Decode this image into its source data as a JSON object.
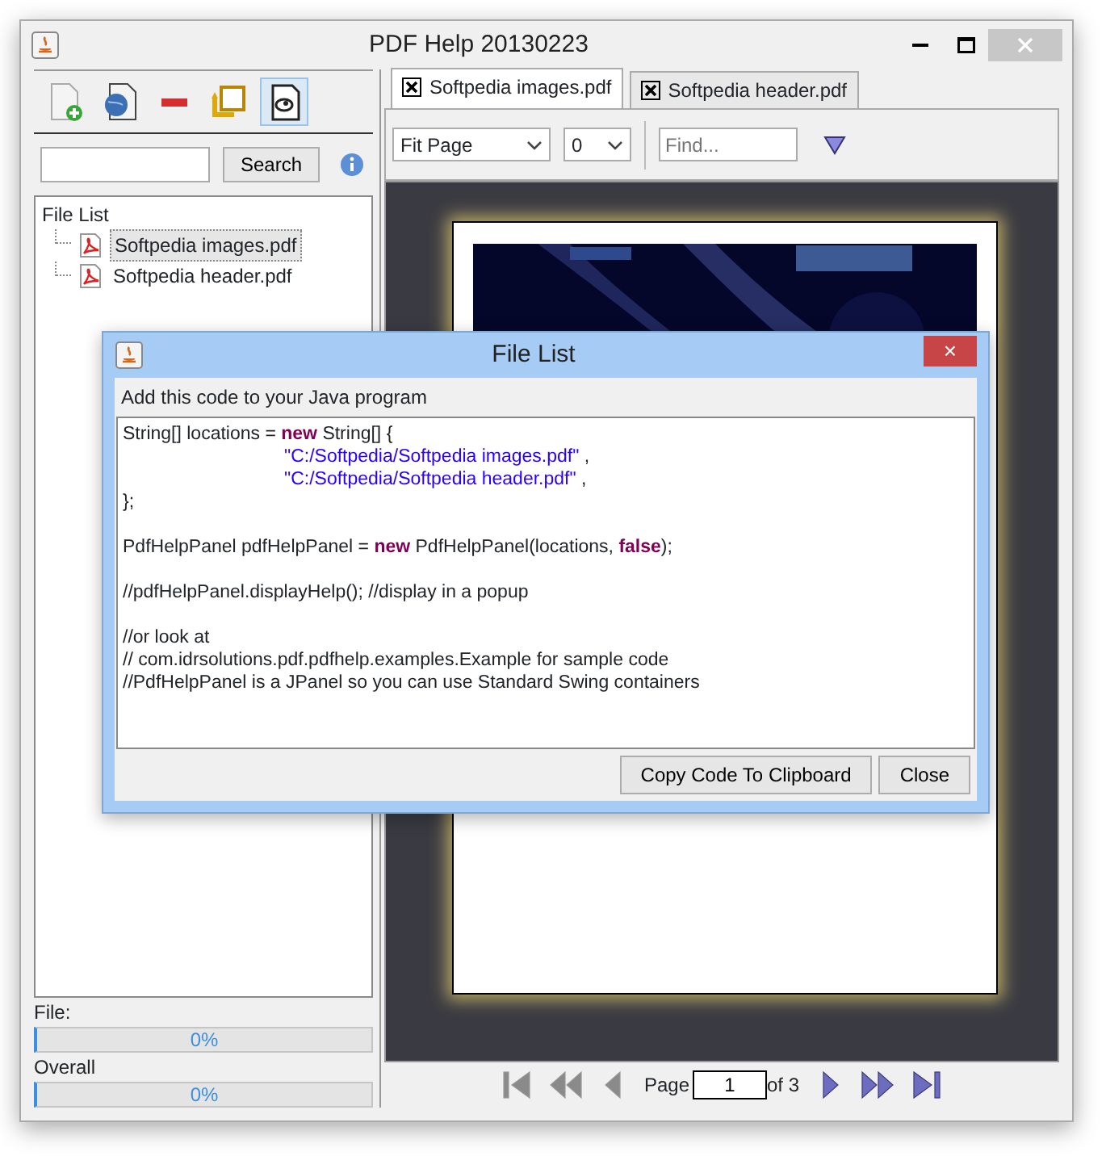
{
  "window": {
    "title": "PDF Help 20130223"
  },
  "toolbar": [
    {
      "kind": "add-file",
      "pressed": false
    },
    {
      "kind": "globe-file",
      "pressed": false
    },
    {
      "kind": "remove",
      "pressed": false
    },
    {
      "kind": "refresh",
      "pressed": false
    },
    {
      "kind": "help-file",
      "pressed": true
    }
  ],
  "search": {
    "button": "Search"
  },
  "tree": {
    "label": "File List",
    "children": [
      {
        "label": "Softpedia images.pdf",
        "selected": true
      },
      {
        "label": "Softpedia header.pdf",
        "selected": false
      }
    ]
  },
  "progress": [
    {
      "label": "File:",
      "level": 0,
      "reading": "0%"
    },
    {
      "label": "Overall",
      "level": 0,
      "reading": "0%"
    }
  ],
  "tabs": [
    {
      "label": "Softpedia images.pdf",
      "selected": true
    },
    {
      "label": "Softpedia header.pdf",
      "selected": false
    }
  ],
  "viewer_toolbar": {
    "zoom": "Fit Page",
    "rotation": "0",
    "find_placeholder": "Find..."
  },
  "navigation": {
    "buttons": [
      {
        "kind": "first",
        "disabled": true
      },
      {
        "kind": "back-ten",
        "disabled": true
      },
      {
        "kind": "back",
        "disabled": true
      }
    ],
    "page_label": "Page",
    "page": "1",
    "of": "of 3",
    "forward": [
      {
        "kind": "next",
        "disabled": false
      },
      {
        "kind": "forward-ten",
        "disabled": false
      },
      {
        "kind": "last",
        "disabled": false
      }
    ]
  },
  "dialog": {
    "title": "File List",
    "close": "×",
    "heading": "Add this code to your Java program",
    "code": [
      {
        "indented": false,
        "blank_before": false,
        "segments": [
          {
            "kind": "plain",
            "text": "String[] locations = "
          },
          {
            "kind": "keyword",
            "text": "new"
          },
          {
            "kind": "plain",
            "text": " String[] {"
          }
        ]
      },
      {
        "indented": true,
        "blank_before": false,
        "segments": [
          {
            "kind": "string",
            "text": "\"C:/Softpedia/Softpedia images.pdf\""
          },
          {
            "kind": "plain",
            "text": " ,"
          }
        ]
      },
      {
        "indented": true,
        "blank_before": false,
        "segments": [
          {
            "kind": "string",
            "text": "\"C:/Softpedia/Softpedia header.pdf\""
          },
          {
            "kind": "plain",
            "text": " ,"
          }
        ]
      },
      {
        "indented": false,
        "blank_before": false,
        "segments": [
          {
            "kind": "plain",
            "text": "};"
          }
        ]
      },
      {
        "indented": false,
        "blank_before": true,
        "segments": [
          {
            "kind": "plain",
            "text": "PdfHelpPanel pdfHelpPanel = "
          },
          {
            "kind": "keyword",
            "text": "new"
          },
          {
            "kind": "plain",
            "text": " PdfHelpPanel(locations, "
          },
          {
            "kind": "keyword",
            "text": "false"
          },
          {
            "kind": "plain",
            "text": ");"
          }
        ]
      },
      {
        "indented": false,
        "blank_before": true,
        "segments": [
          {
            "kind": "plain",
            "text": "//pdfHelpPanel.displayHelp(); //display in a popup"
          }
        ]
      },
      {
        "indented": false,
        "blank_before": true,
        "segments": [
          {
            "kind": "plain",
            "text": "//or look at"
          }
        ]
      },
      {
        "indented": false,
        "blank_before": false,
        "segments": [
          {
            "kind": "plain",
            "text": "// com.idrsolutions.pdf.pdfhelp.examples.Example for sample code"
          }
        ]
      },
      {
        "indented": false,
        "blank_before": false,
        "segments": [
          {
            "kind": "plain",
            "text": "//PdfHelpPanel is a JPanel so you can use Standard Swing containers"
          }
        ]
      }
    ],
    "buttons": [
      "Copy Code To Clipboard",
      "Close"
    ]
  }
}
